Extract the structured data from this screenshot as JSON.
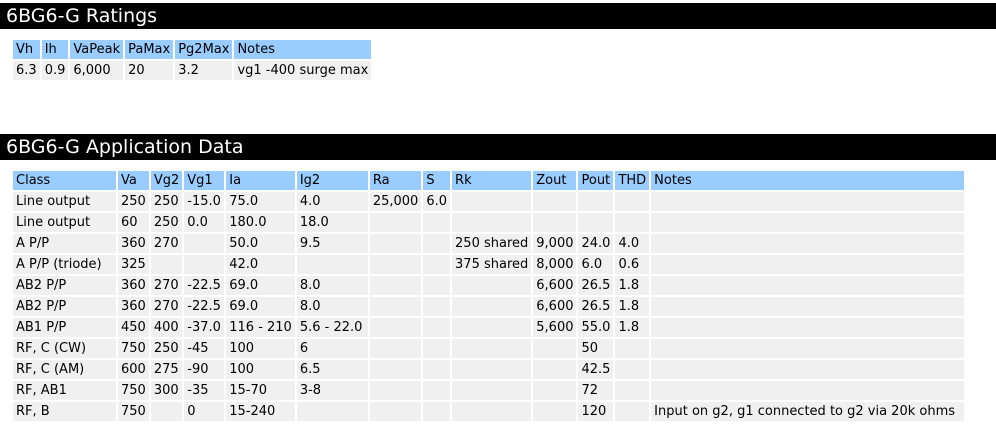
{
  "ratings": {
    "title": "6BG6-G Ratings",
    "headers": [
      "Vh",
      "Ih",
      "VaPeak",
      "PaMax",
      "Pg2Max",
      "Notes"
    ],
    "rows": [
      [
        "6.3",
        "0.9",
        "6,000",
        "20",
        "3.2",
        "vg1 -400 surge max"
      ]
    ]
  },
  "application": {
    "title": "6BG6-G Application Data",
    "headers": [
      "Class",
      "Va",
      "Vg2",
      "Vg1",
      "Ia",
      "Ig2",
      "Ra",
      "S",
      "Rk",
      "Zout",
      "Pout",
      "THD",
      "Notes"
    ],
    "rows": [
      [
        "Line output",
        "250",
        "250",
        "-15.0",
        "75.0",
        "4.0",
        "25,000",
        "6.0",
        "",
        "",
        "",
        "",
        ""
      ],
      [
        "Line output",
        "60",
        "250",
        "0.0",
        "180.0",
        "18.0",
        "",
        "",
        "",
        "",
        "",
        "",
        ""
      ],
      [
        "A P/P",
        "360",
        "270",
        "",
        "50.0",
        "9.5",
        "",
        "",
        "250 shared",
        "9,000",
        "24.0",
        "4.0",
        ""
      ],
      [
        "A P/P (triode)",
        "325",
        "",
        "",
        "42.0",
        "",
        "",
        "",
        "375 shared",
        "8,000",
        "6.0",
        "0.6",
        ""
      ],
      [
        "AB2 P/P",
        "360",
        "270",
        "-22.5",
        "69.0",
        "8.0",
        "",
        "",
        "",
        "6,600",
        "26.5",
        "1.8",
        ""
      ],
      [
        "AB2 P/P",
        "360",
        "270",
        "-22.5",
        "69.0",
        "8.0",
        "",
        "",
        "",
        "6,600",
        "26.5",
        "1.8",
        ""
      ],
      [
        "AB1 P/P",
        "450",
        "400",
        "-37.0",
        "116 - 210",
        "5.6 - 22.0",
        "",
        "",
        "",
        "5,600",
        "55.0",
        "1.8",
        ""
      ],
      [
        "RF, C (CW)",
        "750",
        "250",
        "-45",
        "100",
        "6",
        "",
        "",
        "",
        "",
        "50",
        "",
        ""
      ],
      [
        "RF, C (AM)",
        "600",
        "275",
        "-90",
        "100",
        "6.5",
        "",
        "",
        "",
        "",
        "42.5",
        "",
        ""
      ],
      [
        "RF, AB1",
        "750",
        "300",
        "-35",
        "15-70",
        "3-8",
        "",
        "",
        "",
        "",
        "72",
        "",
        ""
      ],
      [
        "RF, B",
        "750",
        "",
        "0",
        "15-240",
        "",
        "",
        "",
        "",
        "",
        "120",
        "",
        "Input on g2, g1 connected to g2 via 20k ohms"
      ]
    ]
  }
}
